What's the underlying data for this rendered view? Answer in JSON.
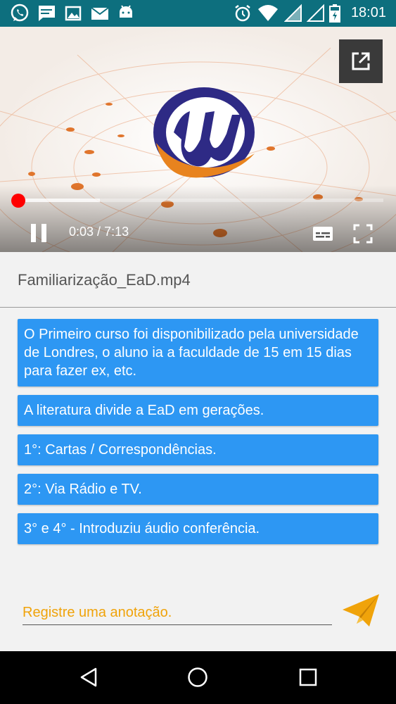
{
  "status_bar": {
    "time": "18:01",
    "left_icons": [
      "whatsapp-icon",
      "message-icon",
      "image-icon",
      "email-icon",
      "android-icon"
    ],
    "right_icons": [
      "alarm-icon",
      "wifi-icon",
      "signal-icon",
      "battery-icon"
    ]
  },
  "player": {
    "current_time": "0:03",
    "separator": " / ",
    "duration": "7:13",
    "progress": 0.007,
    "buffered": 0.23,
    "accent_color": "#ff0000",
    "state": "playing"
  },
  "file": {
    "title": "Familiarização_EaD.mp4"
  },
  "notes": [
    "O Primeiro curso foi disponibilizado pela universidade de Londres, o aluno ia a faculdade de 15 em 15 dias para fazer ex, etc.",
    "A literatura divide a EaD em gerações.",
    "1°: Cartas / Correspondências.",
    "2°: Via Rádio e TV.",
    "3° e 4° - Introduziu áudio conferência."
  ],
  "note_input": {
    "placeholder": "Registre uma anotação.",
    "value": ""
  },
  "colors": {
    "note_background": "#2d97f3",
    "status_bar": "#0d6f7e",
    "send_icon": "#f0a30a"
  }
}
